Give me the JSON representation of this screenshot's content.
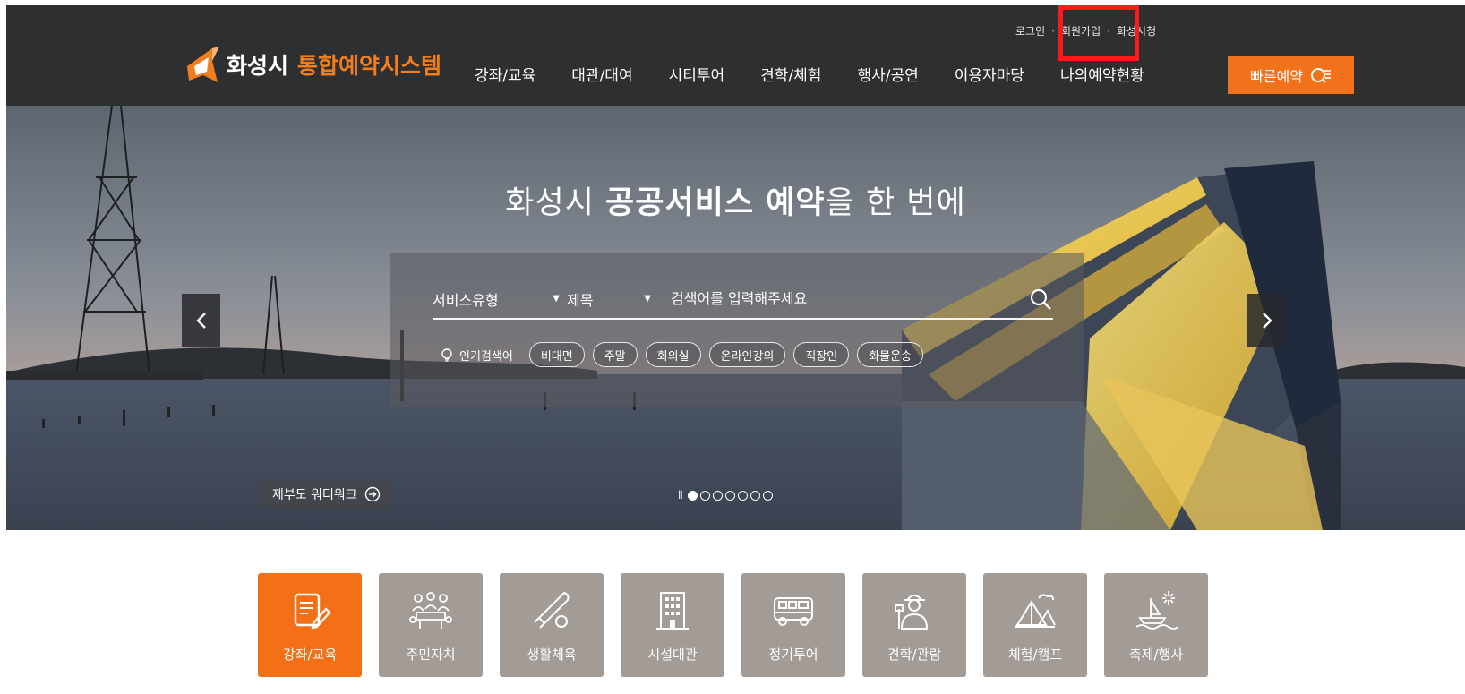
{
  "header": {
    "util_links": [
      "로그인",
      "회원가입",
      "화성시청"
    ],
    "logo": {
      "text_city": "화성시",
      "text_system": "통합예약시스템"
    },
    "nav": [
      "강좌/교육",
      "대관/대여",
      "시티투어",
      "견학/체험",
      "행사/공연",
      "이용자마당",
      "나의예약현황"
    ],
    "quick_button": "빠른예약"
  },
  "hero": {
    "headline_pre": "화성시",
    "headline_bold": "공공서비스 예약",
    "headline_post": "을 한 번에",
    "search": {
      "type_select": "서비스유형",
      "field_select": "제목",
      "placeholder": "검색어를 입력해주세요"
    },
    "popular_label": "인기검색어",
    "popular_tags": [
      "비대면",
      "주말",
      "회의실",
      "온라인강의",
      "직장인",
      "화물운송"
    ],
    "caption": "제부도 워터워크",
    "pager": {
      "total": 7,
      "current": 1
    }
  },
  "categories": [
    {
      "label": "강좌/교육",
      "icon": "edit-document-icon",
      "active": true
    },
    {
      "label": "주민자치",
      "icon": "meeting-people-icon",
      "active": false
    },
    {
      "label": "생활체육",
      "icon": "baseball-bat-icon",
      "active": false
    },
    {
      "label": "시설대관",
      "icon": "building-icon",
      "active": false
    },
    {
      "label": "정기투어",
      "icon": "bus-icon",
      "active": false
    },
    {
      "label": "견학/관람",
      "icon": "guide-person-icon",
      "active": false
    },
    {
      "label": "체험/캠프",
      "icon": "tent-icon",
      "active": false
    },
    {
      "label": "축제/행사",
      "icon": "fireworks-boat-icon",
      "active": false
    }
  ],
  "colors": {
    "accent": "#f2711b",
    "header_bg": "#2d2f31",
    "category_bg": "#a39b95",
    "highlight": "#ff1a1a"
  }
}
